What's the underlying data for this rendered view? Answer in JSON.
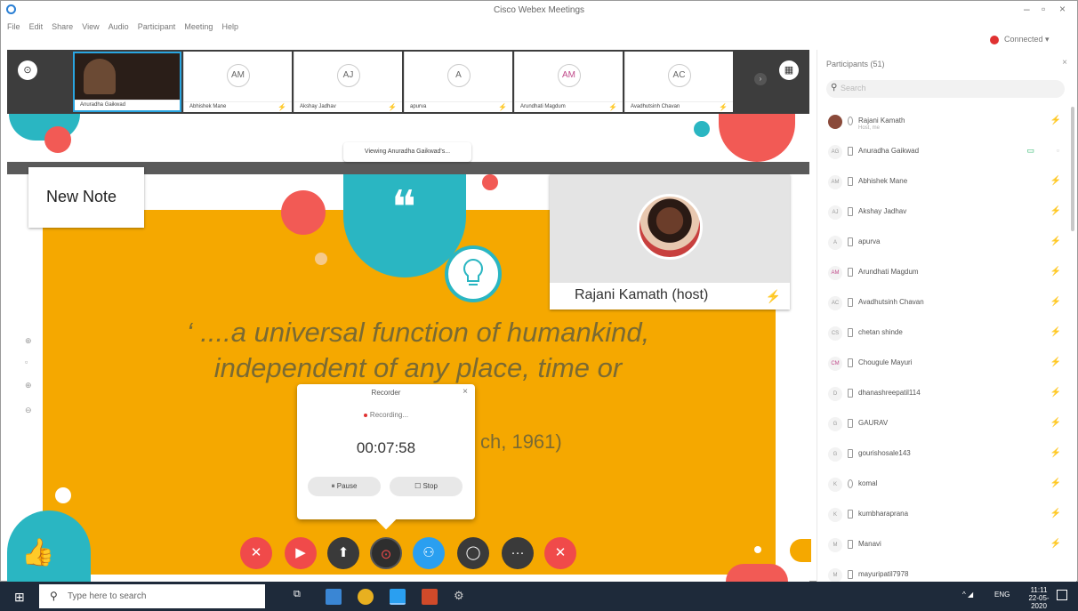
{
  "window": {
    "title": "Cisco Webex Meetings",
    "controls": [
      "–",
      "▫",
      "×"
    ]
  },
  "menu": [
    "File",
    "Edit",
    "Share",
    "View",
    "Audio",
    "Participant",
    "Meeting",
    "Help"
  ],
  "connection": {
    "label": "Connected ▾"
  },
  "strip": {
    "tiles": [
      {
        "initials": "",
        "name": "Anuradha Gaikwad"
      },
      {
        "initials": "AM",
        "name": "Abhishek Mane"
      },
      {
        "initials": "AJ",
        "name": "Akshay Jadhav"
      },
      {
        "initials": "A",
        "name": "apurva"
      },
      {
        "initials": "AM",
        "name": "Arundhati Magdum"
      },
      {
        "initials": "AC",
        "name": "Avadhutsinh Chavan"
      }
    ]
  },
  "viewing_banner": "Viewing Anuradha Gaikwad's...",
  "note": {
    "title": "New Note"
  },
  "slide": {
    "quote_mark": "❝",
    "line1": "‘ ....a universal function of humankind,",
    "line2": "independent of any place, time or",
    "citation": "ch, 1961)"
  },
  "host_video": {
    "name": "Rajani Kamath (host)"
  },
  "recorder": {
    "title": "Recorder",
    "status": "Recording...",
    "time": "00:07:58",
    "pause_label": "⏸ Pause",
    "stop_label": "☐ Stop"
  },
  "controls": [
    {
      "icon": "mic-muted-icon",
      "glyph": "🎙",
      "color": "#f04a4a"
    },
    {
      "icon": "video-off-icon",
      "glyph": "⛔",
      "color": "#f04a4a"
    },
    {
      "icon": "share-icon",
      "glyph": "⬆",
      "color": "#3a3a3a"
    },
    {
      "icon": "record-icon",
      "glyph": "⊙",
      "color": "#2e2e2e"
    },
    {
      "icon": "participants-icon",
      "glyph": "👤",
      "color": "#2a9ff0"
    },
    {
      "icon": "chat-icon",
      "glyph": "◯",
      "color": "#3a3a3a"
    },
    {
      "icon": "more-icon",
      "glyph": "···",
      "color": "#3a3a3a"
    },
    {
      "icon": "end-call-icon",
      "glyph": "✕",
      "color": "#f04a4a"
    }
  ],
  "participants_panel": {
    "header": "Participants (51)",
    "search_placeholder": "Search",
    "rows": [
      {
        "initials": "",
        "name": "Rajani Kamath",
        "sub": "Host, me"
      },
      {
        "initials": "AG",
        "name": "Anuradha Gaikwad",
        "sub": ""
      },
      {
        "initials": "AM",
        "name": "Abhishek Mane",
        "sub": ""
      },
      {
        "initials": "AJ",
        "name": "Akshay Jadhav",
        "sub": ""
      },
      {
        "initials": "A",
        "name": "apurva",
        "sub": ""
      },
      {
        "initials": "AM",
        "name": "Arundhati Magdum",
        "sub": ""
      },
      {
        "initials": "AC",
        "name": "Avadhutsinh Chavan",
        "sub": ""
      },
      {
        "initials": "CS",
        "name": "chetan shinde",
        "sub": ""
      },
      {
        "initials": "CM",
        "name": "Chougule Mayuri",
        "sub": ""
      },
      {
        "initials": "D",
        "name": "dhanashreepatil114",
        "sub": ""
      },
      {
        "initials": "G",
        "name": "GAURAV",
        "sub": ""
      },
      {
        "initials": "G",
        "name": "gourishosale143",
        "sub": ""
      },
      {
        "initials": "K",
        "name": "komal",
        "sub": ""
      },
      {
        "initials": "K",
        "name": "kumbharaprana",
        "sub": ""
      },
      {
        "initials": "M",
        "name": "Manavi",
        "sub": ""
      },
      {
        "initials": "M",
        "name": "mayuripatil7978",
        "sub": ""
      }
    ]
  },
  "taskbar": {
    "search_placeholder": "Type here to search",
    "lang": "ENG",
    "time": "11:11",
    "date": "22-05-2020"
  },
  "colors": {
    "slide_orange": "#f5a800",
    "teal": "#2ab6c2",
    "coral": "#f25a55",
    "mute_red": "#e03131"
  }
}
